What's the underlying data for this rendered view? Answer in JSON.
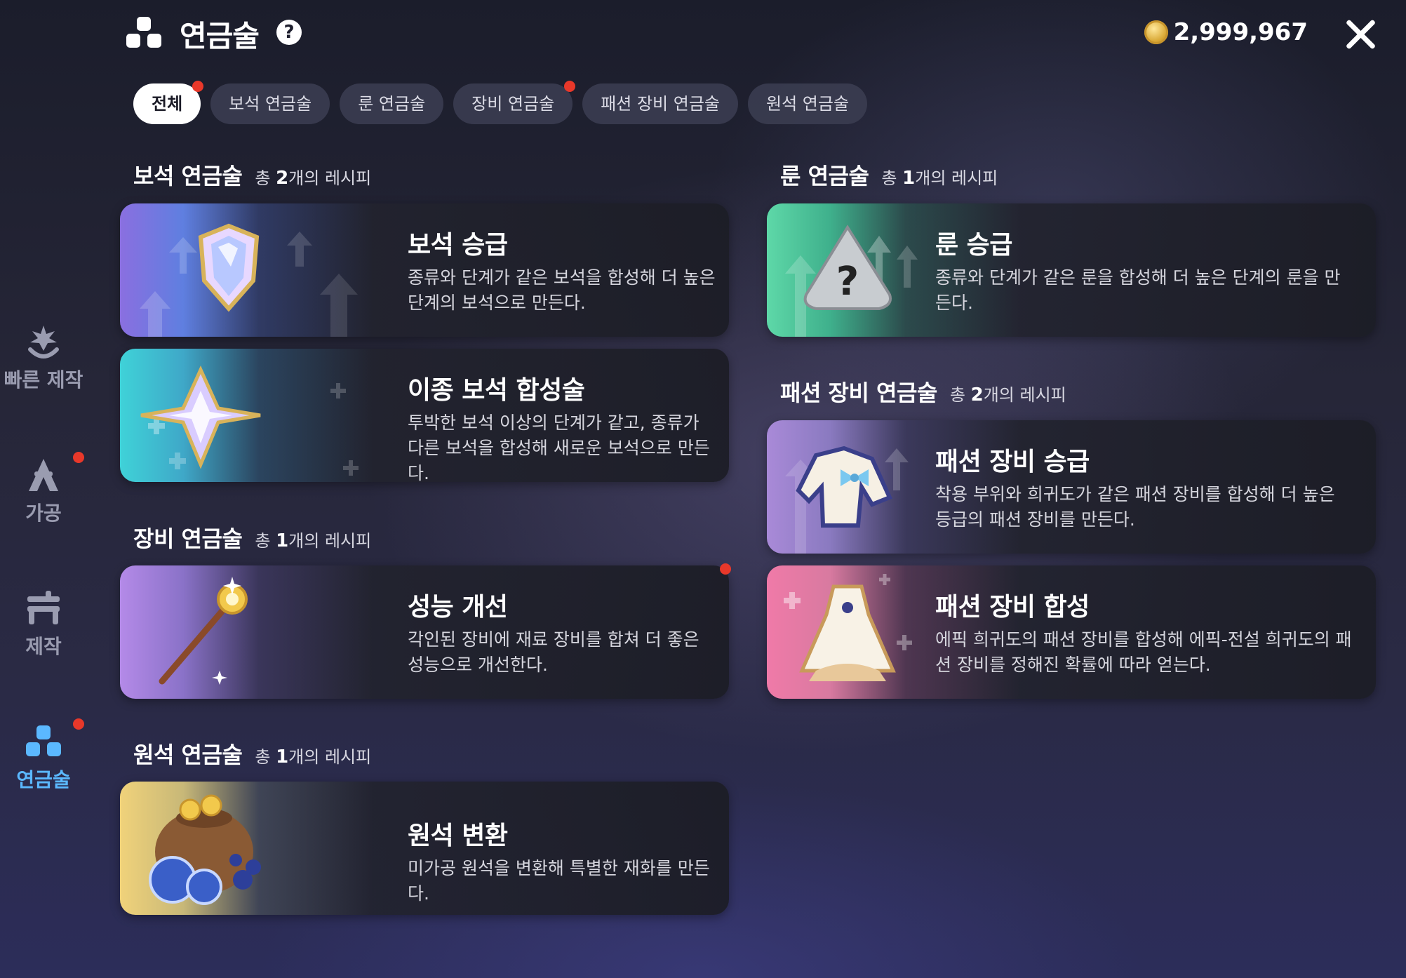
{
  "header": {
    "title": "연금술",
    "help_symbol": "?",
    "currency_amount": "2,999,967"
  },
  "tabs": [
    {
      "label": "전체",
      "active": true,
      "badge": true
    },
    {
      "label": "보석 연금술",
      "active": false,
      "badge": false
    },
    {
      "label": "룬 연금술",
      "active": false,
      "badge": false
    },
    {
      "label": "장비 연금술",
      "active": false,
      "badge": true
    },
    {
      "label": "패션 장비 연금술",
      "active": false,
      "badge": false
    },
    {
      "label": "원석 연금술",
      "active": false,
      "badge": false
    }
  ],
  "sidebar": {
    "items": [
      {
        "label": "빠른 제작",
        "icon": "quick-craft-icon",
        "active": false,
        "badge": false
      },
      {
        "label": "가공",
        "icon": "processing-icon",
        "active": false,
        "badge": true
      },
      {
        "label": "제작",
        "icon": "craft-icon",
        "active": false,
        "badge": false
      },
      {
        "label": "연금술",
        "icon": "alchemy-icon",
        "active": true,
        "badge": true
      }
    ]
  },
  "sections": {
    "gem": {
      "title": "보석 연금술",
      "count_prefix": "총",
      "count": "2",
      "count_suffix": "개의 레시피",
      "cards": [
        {
          "title": "보석 승급",
          "desc": "종류와 단계가 같은 보석을 합성해 더 높은 단계의 보석으로 만든다.",
          "icon": "gem-shield-icon"
        },
        {
          "title": "이종 보석 합성술",
          "desc": "투박한 보석 이상의 단계가 같고, 종류가 다른 보석을 합성해 새로운 보석으로 만든다.",
          "icon": "star-gem-icon"
        }
      ]
    },
    "equipment": {
      "title": "장비 연금술",
      "count_prefix": "총",
      "count": "1",
      "count_suffix": "개의 레시피",
      "cards": [
        {
          "title": "성능 개선",
          "desc": "각인된 장비에 재료 장비를 합쳐 더 좋은 성능으로 개선한다.",
          "icon": "scepter-icon",
          "badge": true
        }
      ]
    },
    "ore": {
      "title": "원석 연금술",
      "count_prefix": "총",
      "count": "1",
      "count_suffix": "개의 레시피",
      "cards": [
        {
          "title": "원석 변환",
          "desc": "미가공 원석을 변환해 특별한 재화를 만든다.",
          "icon": "coin-bag-icon"
        }
      ]
    },
    "rune": {
      "title": "룬 연금술",
      "count_prefix": "총",
      "count": "1",
      "count_suffix": "개의 레시피",
      "cards": [
        {
          "title": "룬 승급",
          "desc": "종류와 단계가 같은 룬을 합성해 더 높은 단계의 룬을 만든다.",
          "icon": "mystery-rune-icon"
        }
      ]
    },
    "fashion": {
      "title": "패션 장비 연금술",
      "count_prefix": "총",
      "count": "2",
      "count_suffix": "개의 레시피",
      "cards": [
        {
          "title": "패션 장비 승급",
          "desc": "착용 부위와 희귀도가 같은 패션 장비를 합성해 더 높은 등급의 패션 장비를 만든다.",
          "icon": "fashion-top-icon"
        },
        {
          "title": "패션 장비 합성",
          "desc": "에픽 희귀도의 패션 장비를 합성해 에픽-전설 희귀도의 패션 장비를 정해진 확률에 따라 얻는다.",
          "icon": "fashion-dress-icon"
        }
      ]
    }
  },
  "colors": {
    "accent_blue": "#5bb8ff",
    "badge_red": "#e8382a",
    "gem_art": "#8a6fe0",
    "star_gem_art": "#3fd2d8",
    "rune_art": "#5ed8a8",
    "fashion_up_art": "#a98ad8",
    "fashion_merge_art": "#f07aa8",
    "scepter_art": "#b48ae8",
    "ore_art": "#f0d27a"
  }
}
